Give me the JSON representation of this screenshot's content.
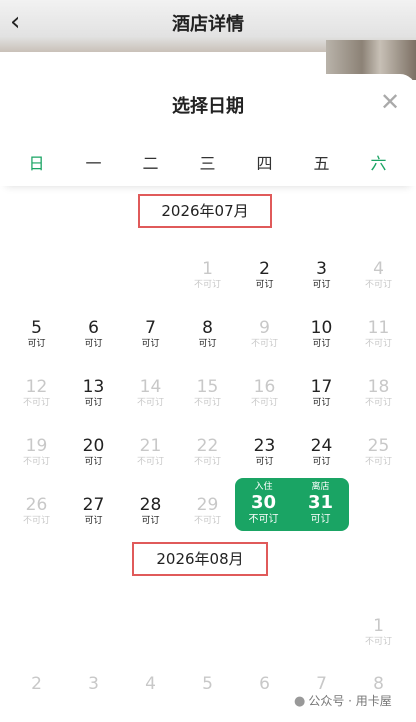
{
  "header": {
    "back_icon": "chevron-left-icon",
    "title": "酒店详情"
  },
  "picker": {
    "title": "选择日期",
    "close_icon": "close-icon"
  },
  "weekdays": [
    "日",
    "一",
    "二",
    "三",
    "四",
    "五",
    "六"
  ],
  "months": [
    "2026年07月",
    "2026年08月"
  ],
  "labels": {
    "available": "可订",
    "unavailable": "不可订",
    "checkin": "入住",
    "checkout": "离店"
  },
  "july": {
    "rows": [
      [
        {
          "d": ""
        },
        {
          "d": ""
        },
        {
          "d": ""
        },
        {
          "d": "1",
          "s": "不可订"
        },
        {
          "d": "2",
          "s": "可订"
        },
        {
          "d": "3",
          "s": "可订"
        },
        {
          "d": "4",
          "s": "不可订"
        }
      ],
      [
        {
          "d": "5",
          "s": "可订"
        },
        {
          "d": "6",
          "s": "可订"
        },
        {
          "d": "7",
          "s": "可订"
        },
        {
          "d": "8",
          "s": "可订"
        },
        {
          "d": "9",
          "s": "不可订"
        },
        {
          "d": "10",
          "s": "可订"
        },
        {
          "d": "11",
          "s": "不可订"
        }
      ],
      [
        {
          "d": "12",
          "s": "不可订"
        },
        {
          "d": "13",
          "s": "可订"
        },
        {
          "d": "14",
          "s": "不可订"
        },
        {
          "d": "15",
          "s": "不可订"
        },
        {
          "d": "16",
          "s": "不可订"
        },
        {
          "d": "17",
          "s": "可订"
        },
        {
          "d": "18",
          "s": "不可订"
        }
      ],
      [
        {
          "d": "19",
          "s": "不可订"
        },
        {
          "d": "20",
          "s": "可订"
        },
        {
          "d": "21",
          "s": "不可订"
        },
        {
          "d": "22",
          "s": "不可订"
        },
        {
          "d": "23",
          "s": "可订"
        },
        {
          "d": "24",
          "s": "可订"
        },
        {
          "d": "25",
          "s": "不可订"
        }
      ],
      [
        {
          "d": "26",
          "s": "不可订"
        },
        {
          "d": "27",
          "s": "可订"
        },
        {
          "d": "28",
          "s": "可订"
        },
        {
          "d": "29",
          "s": "不可订"
        }
      ]
    ],
    "checkin": {
      "tag": "入住",
      "d": "30",
      "s": "不可订"
    },
    "checkout": {
      "tag": "离店",
      "d": "31",
      "s": "可订"
    }
  },
  "august": {
    "row1": [
      {
        "d": "1",
        "s": "不可订"
      }
    ],
    "row2": [
      "2",
      "3",
      "4",
      "5",
      "6",
      "7",
      "8"
    ]
  },
  "watermark": {
    "icon": "wechat-icon",
    "text": "公众号 · 用卡屋"
  },
  "colors": {
    "accent": "#1aa464",
    "highlight_box": "#e05a5a"
  }
}
